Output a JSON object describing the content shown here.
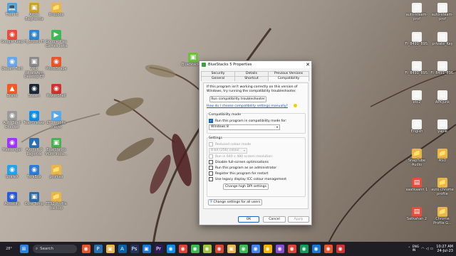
{
  "desktop": {
    "left_icons": [
      {
        "label": "This PC",
        "glyph": "💻",
        "color": "#4aa3df"
      },
      {
        "label": "Arora Baghanda",
        "glyph": "▣",
        "color": "#c9a227"
      },
      {
        "label": "Dropbox",
        "glyph": "📁",
        "color": "#e8b64a"
      },
      {
        "label": "Google Keep",
        "glyph": "◉",
        "color": "#e84c3d"
      },
      {
        "label": "H_Studio H",
        "glyph": "◉",
        "color": "#2f86d4"
      },
      {
        "label": "Google Play Games beta",
        "glyph": "▶",
        "color": "#3cba54"
      },
      {
        "label": "Decam Fact",
        "glyph": "◉",
        "color": "#6aa6e8"
      },
      {
        "label": "Win WhatsApp Desktop ET",
        "glyph": "▣",
        "color": "#8b8b8b"
      },
      {
        "label": "PhotoScape",
        "glyph": "◉",
        "color": "#e8542b"
      },
      {
        "label": "Brave",
        "glyph": "▲",
        "color": "#f05a24"
      },
      {
        "label": "Steam",
        "glyph": "◉",
        "color": "#1b2838"
      },
      {
        "label": "PowerShell",
        "glyph": "◉",
        "color": "#d0312d"
      },
      {
        "label": "Auto Spell Checker",
        "glyph": "◉",
        "color": "#9a9a9a"
      },
      {
        "label": "TeamViewer",
        "glyph": "◉",
        "color": "#0e8ee9"
      },
      {
        "label": "LTC mobile player",
        "glyph": "▶",
        "color": "#5aa9e6"
      },
      {
        "label": "Messenger",
        "glyph": "◉",
        "color": "#a033ff"
      },
      {
        "label": "Asphalt 9 Legends",
        "glyph": "▲",
        "color": "#2b6fb3"
      },
      {
        "label": "BlueStacks Multi-Insta...",
        "glyph": "▣",
        "color": "#4caf50"
      },
      {
        "label": "ShareX",
        "glyph": "◉",
        "color": "#27a0e8"
      },
      {
        "label": "TeraBox",
        "glyph": "◉",
        "color": "#2b7bd9"
      },
      {
        "label": "profiles",
        "glyph": "📁",
        "color": "#e8b64a"
      },
      {
        "label": "Audacity",
        "glyph": "◉",
        "color": "#2a5bd7"
      },
      {
        "label": "Core Temp",
        "glyph": "▣",
        "color": "#2d6ca8"
      },
      {
        "label": "ETS2 Profile backup",
        "glyph": "📁",
        "color": "#e8b64a"
      }
    ],
    "mid_icon": {
      "label": "BlueStacks 5",
      "glyph": "▣",
      "color": "#6fbf3f"
    },
    "right_icons": [
      {
        "label": "auto-steam-prof",
        "glyph": "▤",
        "color": "#f2f2f2"
      },
      {
        "label": "auto-steam-prof",
        "glyph": "▤",
        "color": "#f2f2f2"
      },
      {
        "label": "FI_8491_895...",
        "glyph": "▤",
        "color": "#f2f2f2"
      },
      {
        "label": "private_Key",
        "glyph": "▤",
        "color": "#f2f2f2"
      },
      {
        "label": "FI_8491_895...",
        "glyph": "▤",
        "color": "#f2f2f2"
      },
      {
        "label": "FI_8491_896...",
        "glyph": "▤",
        "color": "#f2f2f2"
      },
      {
        "label": "etc2",
        "glyph": "▤",
        "color": "#f2f2f2"
      },
      {
        "label": "APKjunk",
        "glyph": "▤",
        "color": "#f2f2f2"
      },
      {
        "label": "Engish",
        "glyph": "▤",
        "color": "#f2f2f2"
      },
      {
        "label": "yaple",
        "glyph": "▤",
        "color": "#f2f2f2"
      },
      {
        "label": "SnapTube Audio",
        "glyph": "📁",
        "color": "#e8b64a"
      },
      {
        "label": "ASD",
        "glyph": "📁",
        "color": "#e8b64a"
      },
      {
        "label": "saatkaann 1",
        "glyph": "▤",
        "color": "#e84c3d"
      },
      {
        "label": "auto chrome profile",
        "glyph": "📁",
        "color": "#e8b64a"
      },
      {
        "label": "Satkahan 2",
        "glyph": "▤",
        "color": "#e84c3d"
      },
      {
        "label": "Chrome Profile G...",
        "glyph": "📁",
        "color": "#e8b64a"
      }
    ]
  },
  "dialog": {
    "title": "BlueStacks 5 Properties",
    "close": "✕",
    "tabs": {
      "security": "Security",
      "details": "Details",
      "previous_versions": "Previous Versions",
      "general": "General",
      "shortcut": "Shortcut",
      "compatibility": "Compatibility"
    },
    "intro": "If this program isn't working correctly on this version of Windows, try running the compatibility troubleshooter.",
    "troubleshooter_button": "Run compatibility troubleshooter",
    "manual_link": "How do I choose compatibility settings manually?",
    "compat_mode": {
      "group_label": "Compatibility mode",
      "checkbox_label": "Run this program in compatibility mode for:",
      "checked": true,
      "selected_os": "Windows 8"
    },
    "settings": {
      "group_label": "Settings",
      "reduced_colour": "Reduced colour mode",
      "colour_value": "8-bit (256) colour",
      "res_640": "Run in 640 x 480 screen resolution",
      "fullscreen_opt": "Disable full-screen optimisations",
      "admin": "Run this program as an administrator",
      "restart": "Register this program for restart",
      "icc": "Use legacy display ICC colour management",
      "dpi_button": "Change high DPI settings"
    },
    "all_users_button": "Change settings for all users",
    "ok": "OK",
    "cancel": "Cancel",
    "apply": "Apply"
  },
  "taskbar": {
    "search_placeholder": "Search",
    "temperature": "28°",
    "language": "ENG\nIN",
    "time": "10:27 AM",
    "date": "24-Jul-23",
    "apps": [
      {
        "name": "tb-app-1",
        "glyph": "◉",
        "color": "#e8542b"
      },
      {
        "name": "tb-app-2",
        "glyph": "P",
        "color": "#2b6fb3"
      },
      {
        "name": "tb-app-3",
        "glyph": "▣",
        "color": "#e8b64a"
      },
      {
        "name": "tb-app-4",
        "glyph": "A",
        "color": "#0b5fa5"
      },
      {
        "name": "tb-app-5",
        "glyph": "Ps",
        "color": "#26345c"
      },
      {
        "name": "tb-app-6",
        "glyph": "▣",
        "color": "#1779d6"
      },
      {
        "name": "tb-app-7",
        "glyph": "Pr",
        "color": "#2d1a58"
      },
      {
        "name": "tb-app-8",
        "glyph": "◉",
        "color": "#0e8ee9"
      },
      {
        "name": "tb-app-9",
        "glyph": "◉",
        "color": "#db4437"
      },
      {
        "name": "tb-app-10",
        "glyph": "◉",
        "color": "#3cba54"
      },
      {
        "name": "tb-app-11",
        "glyph": "◉",
        "color": "#a4c639"
      },
      {
        "name": "tb-app-12",
        "glyph": "◉",
        "color": "#db4437"
      },
      {
        "name": "tb-app-13",
        "glyph": "▣",
        "color": "#e8b64a"
      },
      {
        "name": "tb-app-14",
        "glyph": "◉",
        "color": "#3cba54"
      },
      {
        "name": "tb-app-15",
        "glyph": "◉",
        "color": "#4285f4"
      },
      {
        "name": "tb-app-16",
        "glyph": "◉",
        "color": "#f4b400"
      },
      {
        "name": "tb-app-17",
        "glyph": "◉",
        "color": "#8a4ed1"
      },
      {
        "name": "tb-app-18",
        "glyph": "◉",
        "color": "#db4437"
      },
      {
        "name": "tb-app-19",
        "glyph": "◉",
        "color": "#0f9d58"
      },
      {
        "name": "tb-app-20",
        "glyph": "◉",
        "color": "#1779d6"
      },
      {
        "name": "tb-app-21",
        "glyph": "◉",
        "color": "#e8542b"
      },
      {
        "name": "tb-app-22",
        "glyph": "◉",
        "color": "#c33"
      }
    ]
  }
}
